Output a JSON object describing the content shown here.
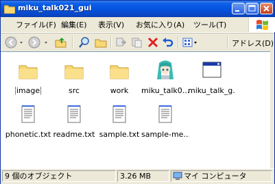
{
  "window": {
    "title": "miku_talk021_gui"
  },
  "menu": {
    "items": [
      "ファイル(F)",
      "編集(E)",
      "表示(V)",
      "お気に入り(A)",
      "ツール(T)"
    ]
  },
  "toolbar": {
    "address_label": "アドレス(D)"
  },
  "files": [
    {
      "name": "image",
      "type": "folder"
    },
    {
      "name": "src",
      "type": "folder"
    },
    {
      "name": "work",
      "type": "folder"
    },
    {
      "name": "miku_talk0...",
      "type": "exe-image"
    },
    {
      "name": "miku_talk_g...",
      "type": "window-app"
    },
    {
      "name": "phonetic.txt",
      "type": "text"
    },
    {
      "name": "readme.txt",
      "type": "text"
    },
    {
      "name": "sample.txt",
      "type": "text"
    },
    {
      "name": "sample-me...",
      "type": "text"
    }
  ],
  "status": {
    "count": "9 個のオブジェクト",
    "size": "3.26 MB",
    "location": "マイ コンピュータ"
  },
  "colors": {
    "titlebar": "#0454e0",
    "chrome": "#ece9d8",
    "close": "#c5401c"
  }
}
